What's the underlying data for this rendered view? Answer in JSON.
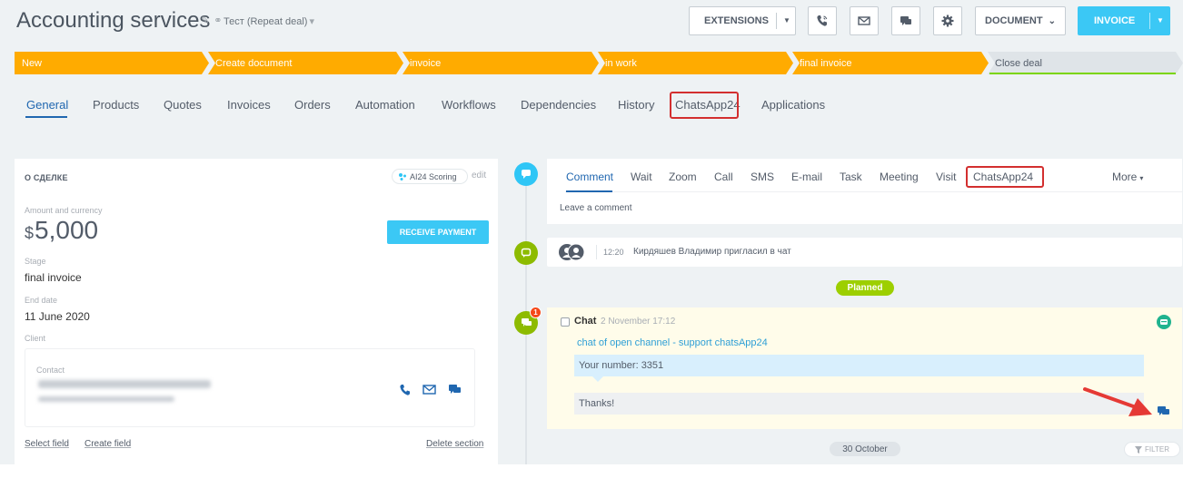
{
  "header": {
    "title": "Accounting services",
    "deal_type": "Тест (Repeat deal)",
    "extensions_label": "EXTENSIONS",
    "document_label": "DOCUMENT",
    "invoice_label": "INVOICE",
    "icons": [
      "pencil-icon",
      "link-icon",
      "phone-icon",
      "envelope-icon",
      "chat-icon",
      "gear-icon"
    ]
  },
  "pipeline": {
    "stages": [
      {
        "label": "New",
        "color": "#ffab00"
      },
      {
        "label": "Create document",
        "color": "#ffab00"
      },
      {
        "label": "invoice",
        "color": "#ffab00"
      },
      {
        "label": "in work",
        "color": "#ffab00"
      },
      {
        "label": "final invoice",
        "color": "#ffab00"
      },
      {
        "label": "Close deal",
        "color": "#dfe4e8"
      }
    ]
  },
  "tabs": [
    {
      "label": "General"
    },
    {
      "label": "Products"
    },
    {
      "label": "Quotes"
    },
    {
      "label": "Invoices"
    },
    {
      "label": "Orders"
    },
    {
      "label": "Automation"
    },
    {
      "label": "Workflows"
    },
    {
      "label": "Dependencies"
    },
    {
      "label": "History"
    },
    {
      "label": "ChatsApp24"
    },
    {
      "label": "Applications"
    }
  ],
  "about": {
    "title": "О СДЕЛКЕ",
    "scoring_label": "AI24 Scoring",
    "edit_label": "edit",
    "amount_label": "Amount and currency",
    "currency_symbol": "$",
    "amount": "5,000",
    "receive_payment_label": "RECEIVE PAYMENT",
    "stage_label": "Stage",
    "stage_value": "final invoice",
    "end_date_label": "End date",
    "end_date_value": "11 June 2020",
    "client_label": "Client",
    "contact_label": "Contact",
    "select_field_label": "Select field",
    "create_field_label": "Create field",
    "delete_section_label": "Delete section"
  },
  "timeline": {
    "editor_tabs": [
      {
        "label": "Comment"
      },
      {
        "label": "Wait"
      },
      {
        "label": "Zoom"
      },
      {
        "label": "Call"
      },
      {
        "label": "SMS"
      },
      {
        "label": "E-mail"
      },
      {
        "label": "Task"
      },
      {
        "label": "Meeting"
      },
      {
        "label": "Visit"
      },
      {
        "label": "ChatsApp24"
      }
    ],
    "more_label": "More",
    "comment_placeholder": "Leave a comment",
    "event_time": "12:20",
    "event_text": "Кирдяшев Владимир пригласил в чат",
    "planned_label": "Planned",
    "chat": {
      "badge": "1",
      "title": "Chat",
      "date": "2 November 17:12",
      "link": "chat of open channel - support chatsApp24",
      "message_in": "Your number: 3351",
      "message_out": "Thanks!"
    },
    "date_separator": "30 October",
    "filter_label": "FILTER"
  },
  "colors": {
    "accent": "#3bc8f5",
    "link_blue": "#2067b0",
    "pipeline_active": "#ffab00",
    "pipeline_inactive": "#dfe4e8",
    "highlight_red": "#d32f2f",
    "timeline_blue": "#2fc6f6",
    "timeline_green": "#8dbb00"
  }
}
